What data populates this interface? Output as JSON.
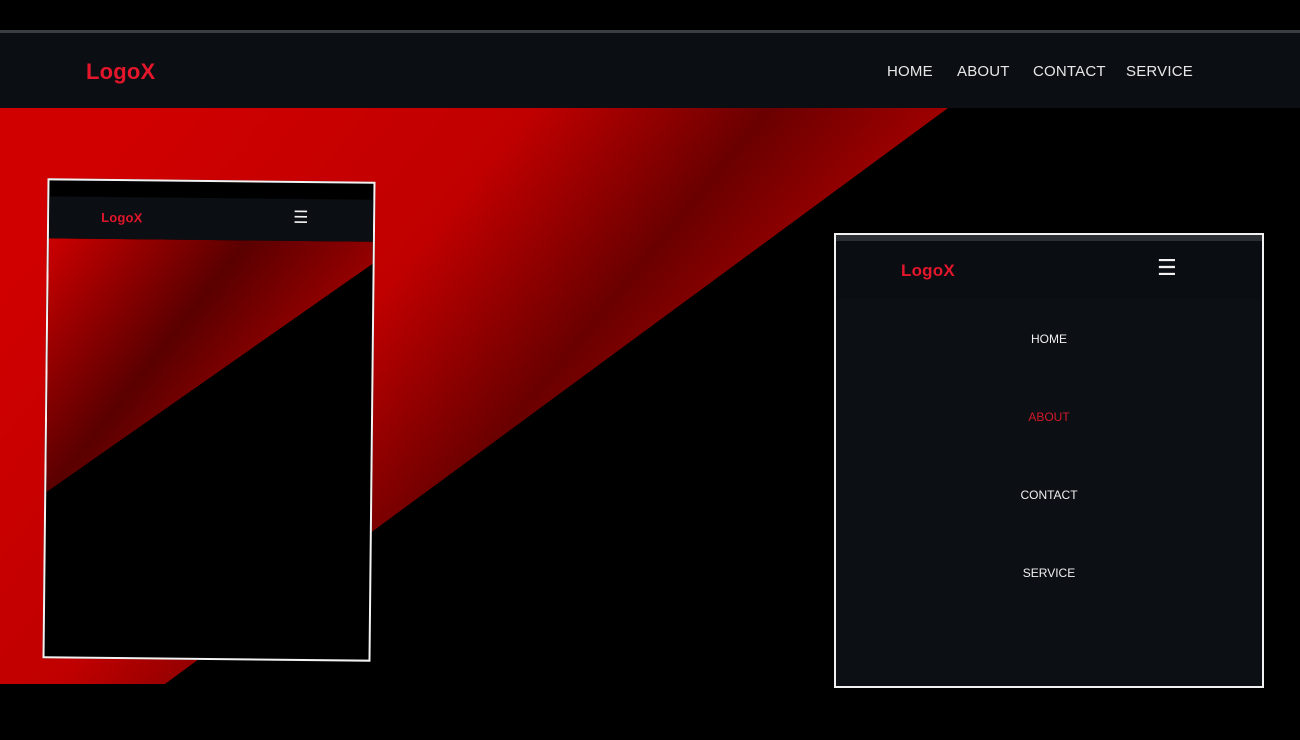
{
  "brand": {
    "logo_text": "LogoX",
    "accent_color": "#e3162c"
  },
  "desktop_nav": {
    "items": [
      {
        "label": "HOME"
      },
      {
        "label": "ABOUT"
      },
      {
        "label": "CONTACT"
      },
      {
        "label": "SERVICE"
      }
    ]
  },
  "phone_preview": {
    "logo_text": "LogoX",
    "menu_icon": "hamburger-icon",
    "menu_glyph": "☰"
  },
  "mobile_menu": {
    "logo_text": "LogoX",
    "menu_icon": "hamburger-icon",
    "menu_glyph": "☰",
    "items": [
      {
        "label": "HOME"
      },
      {
        "label": "ABOUT"
      },
      {
        "label": "CONTACT"
      },
      {
        "label": "SERVICE"
      }
    ],
    "active_item": "ABOUT"
  },
  "colors": {
    "background": "#000000",
    "navbar": "#0b0e12",
    "menu_panel": "#0c1015",
    "red": "#cc0000",
    "dark_red": "#6a0000"
  }
}
